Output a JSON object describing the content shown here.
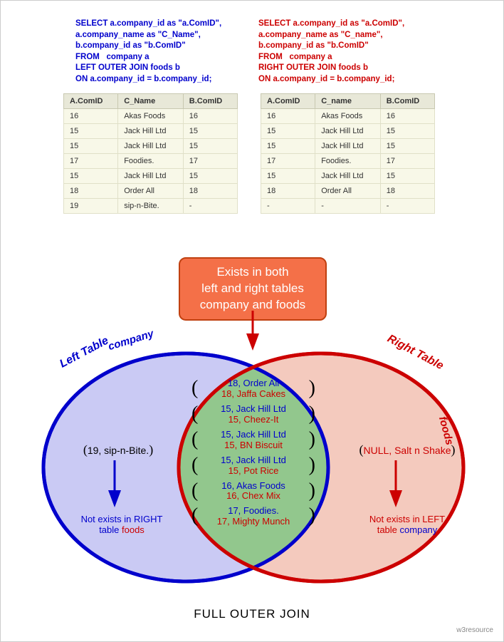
{
  "sql_left": "SELECT a.company_id as \"a.ComID\",\na.company_name as \"C_Name\",\nb.company_id as \"b.ComID\"\nFROM   company a\nLEFT OUTER JOIN foods b\nON a.company_id = b.company_id;",
  "sql_right": "SELECT a.company_id as \"a.ComID\",\na.company_name as \"C_name\",\nb.company_id as \"b.ComID\"\nFROM   company a\nRIGHT OUTER JOIN foods b\nON a.company_id = b.company_id;",
  "left_table": {
    "headers": [
      "A.ComID",
      "C_Name",
      "B.ComID"
    ],
    "rows": [
      [
        "16",
        "Akas Foods",
        "16"
      ],
      [
        "15",
        "Jack Hill Ltd",
        "15"
      ],
      [
        "15",
        "Jack Hill Ltd",
        "15"
      ],
      [
        "17",
        "Foodies.",
        "17"
      ],
      [
        "15",
        "Jack Hill Ltd",
        "15"
      ],
      [
        "18",
        "Order All",
        "18"
      ],
      [
        "19",
        "sip-n-Bite.",
        "-"
      ]
    ]
  },
  "right_table": {
    "headers": [
      "A.ComID",
      "C_name",
      "B.ComID"
    ],
    "rows": [
      [
        "16",
        "Akas Foods",
        "16"
      ],
      [
        "15",
        "Jack Hill Ltd",
        "15"
      ],
      [
        "15",
        "Jack Hill Ltd",
        "15"
      ],
      [
        "17",
        "Foodies.",
        "17"
      ],
      [
        "15",
        "Jack Hill Ltd",
        "15"
      ],
      [
        "18",
        "Order All",
        "18"
      ],
      [
        "-",
        "-",
        "-"
      ]
    ]
  },
  "center_box": "Exists in both\nleft and right tables\ncompany and foods",
  "labels": {
    "left": "Left Table",
    "left_sub": "company",
    "right": "Right Table",
    "right_sub": "foods"
  },
  "left_only": "19, sip-n-Bite.",
  "right_only": "NULL, Salt n Shake",
  "left_note_1": "Not exists in RIGHT",
  "left_note_2a": "table ",
  "left_note_2b": "foods",
  "right_note_1": "Not exists in LEFT",
  "right_note_2a": "table ",
  "right_note_2b": "company",
  "intersect": [
    {
      "blue": "18, Order All",
      "red": "18, Jaffa Cakes"
    },
    {
      "blue": "15, Jack Hill Ltd",
      "red": "15, Cheez-It"
    },
    {
      "blue": "15, Jack Hill Ltd",
      "red": "15, BN Biscuit"
    },
    {
      "blue": "15, Jack Hill Ltd",
      "red": "15, Pot Rice"
    },
    {
      "blue": "16, Akas Foods",
      "red": "16, Chex Mix"
    },
    {
      "blue": "17, Foodies.",
      "red": "17, Mighty Munch"
    }
  ],
  "bottom_title": "FULL OUTER JOIN",
  "credit": "w3resource"
}
